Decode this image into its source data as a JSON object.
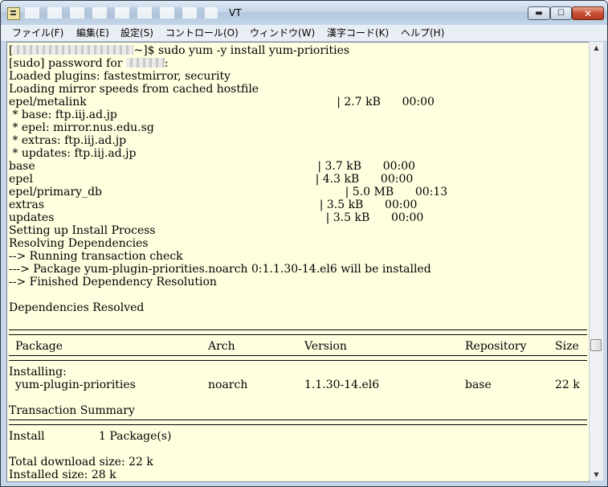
{
  "window": {
    "title": "VT"
  },
  "menu": [
    {
      "label": "ファイル(F)"
    },
    {
      "label": "編集(E)"
    },
    {
      "label": "設定(S)"
    },
    {
      "label": "コントロール(O)"
    },
    {
      "label": "ウィンドウ(W)"
    },
    {
      "label": "漢字コード(K)"
    },
    {
      "label": "ヘルプ(H)"
    }
  ],
  "controls": {
    "minimize": "▬",
    "maximize": "☐",
    "close": "✕"
  },
  "terminal": {
    "prompt_open": "[",
    "prompt_cmd": "~]$ sudo yum -y install yum-priorities",
    "sudo_prompt": "[sudo] password for ",
    "sudo_end": ":",
    "output": [
      "Loaded plugins: fastestmirror, security",
      "Loading mirror speeds from cached hostfile",
      "epel/metalink                                                                      | 2.7 kB      00:00",
      " * base: ftp.iij.ad.jp",
      " * epel: mirror.nus.edu.sg",
      " * extras: ftp.iij.ad.jp",
      " * updates: ftp.iij.ad.jp",
      "base                                                                               | 3.7 kB      00:00",
      "epel                                                                               | 4.3 kB      00:00",
      "epel/primary_db                                                                    | 5.0 MB      00:13",
      "extras                                                                             | 3.5 kB      00:00",
      "updates                                                                            | 3.5 kB      00:00",
      "Setting up Install Process",
      "Resolving Dependencies",
      "--> Running transaction check",
      "---> Package yum-plugin-priorities.noarch 0:1.1.30-14.el6 will be installed",
      "--> Finished Dependency Resolution",
      "",
      "Dependencies Resolved"
    ],
    "table_header": {
      "package": "Package",
      "arch": "Arch",
      "version": "Version",
      "repository": "Repository",
      "size": "Size"
    },
    "installing_label": "Installing:",
    "row": {
      "package": "yum-plugin-priorities",
      "arch": "noarch",
      "version": "1.1.30-14.el6",
      "repository": "base",
      "size": "22 k"
    },
    "summary_title": "Transaction Summary",
    "install_label": "Install",
    "install_count": "1 Package(s)",
    "download_size": "Total download size: 22 k",
    "installed_size": "Installed size: 28 k"
  },
  "scrollbar": {
    "up_arrow": "▲",
    "down_arrow": "▼"
  }
}
